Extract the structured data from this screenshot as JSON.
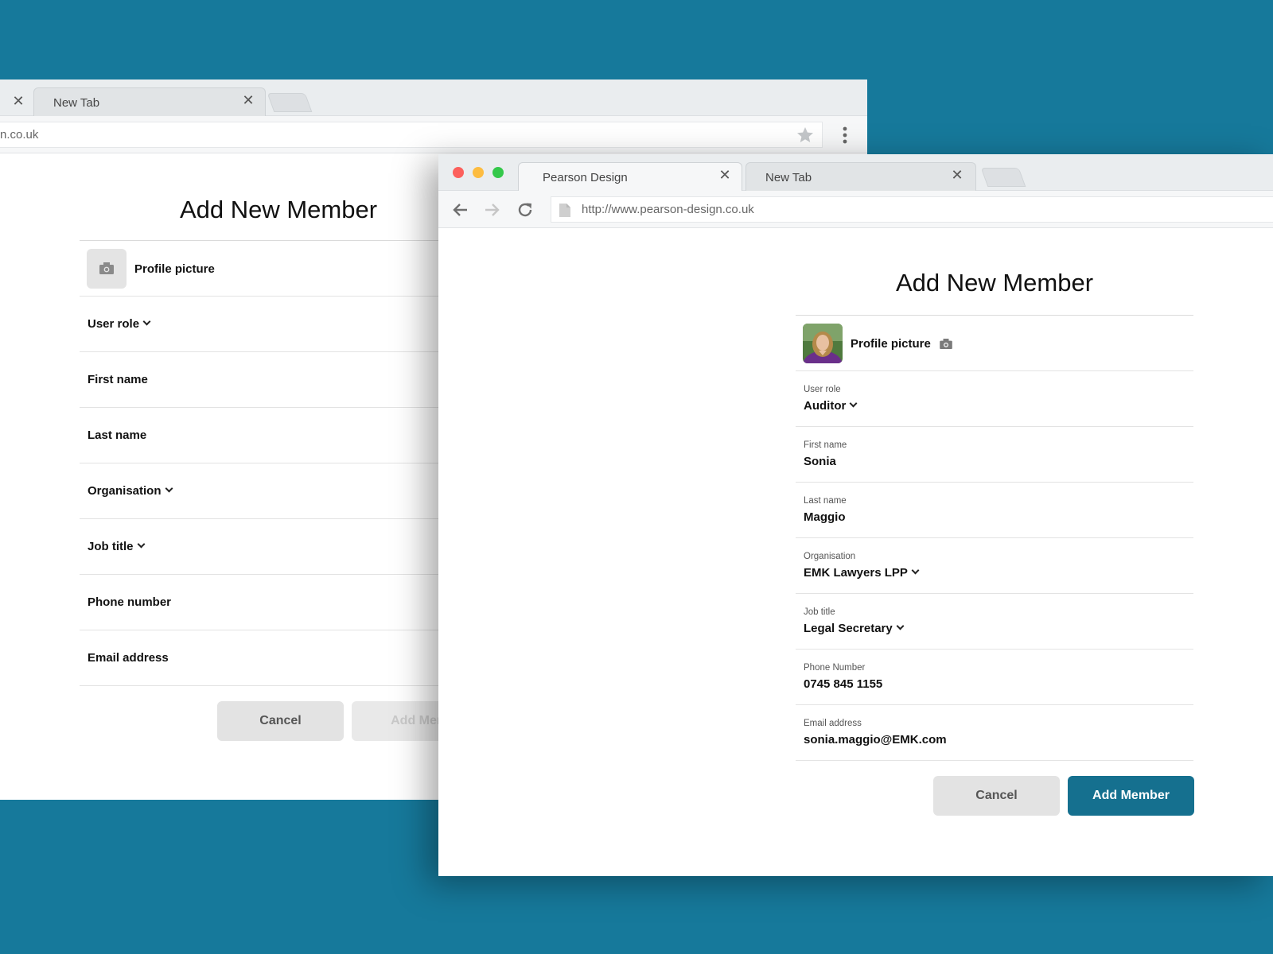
{
  "back_window": {
    "tab_new": "New Tab",
    "url_fragment": "n.co.uk",
    "form": {
      "title": "Add New Member",
      "profile_label": "Profile picture",
      "fields": [
        "User role",
        "First name",
        "Last name",
        "Organisation",
        "Job title",
        "Phone number",
        "Email address"
      ],
      "cancel_label": "Cancel",
      "add_label": "Add Memb"
    }
  },
  "front_window": {
    "tab_active": "Pearson Design",
    "tab_new": "New Tab",
    "url": "http://www.pearson-design.co.uk",
    "form": {
      "title": "Add New Member",
      "profile_label": "Profile picture",
      "fields": [
        {
          "label": "User role",
          "value": "Auditor"
        },
        {
          "label": "First name",
          "value": "Sonia"
        },
        {
          "label": "Last name",
          "value": "Maggio"
        },
        {
          "label": "Organisation",
          "value": "EMK Lawyers LPP"
        },
        {
          "label": "Job title",
          "value": "Legal Secretary"
        },
        {
          "label": "Phone Number",
          "value": "0745 845 1155"
        },
        {
          "label": "Email address",
          "value": "sonia.maggio@EMK.com"
        }
      ],
      "cancel_label": "Cancel",
      "add_label": "Add Member"
    }
  },
  "colors": {
    "background": "#16799b",
    "primary_button": "#15708f",
    "traffic_close": "#fc605c",
    "traffic_minimize": "#fdbc40",
    "traffic_maximize": "#34c84a"
  }
}
